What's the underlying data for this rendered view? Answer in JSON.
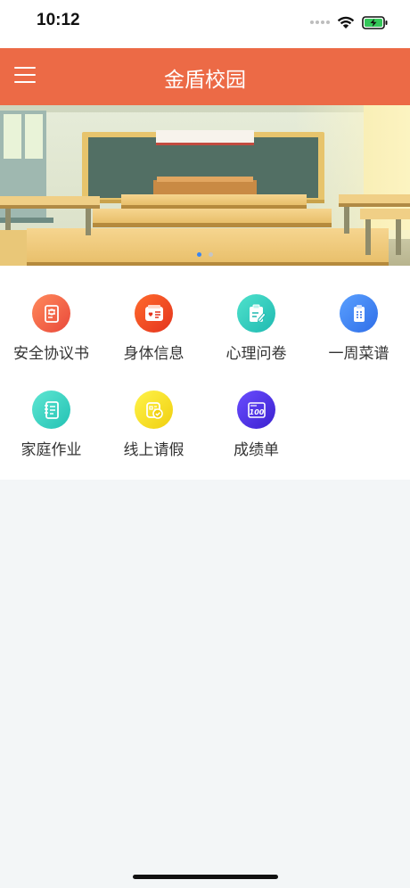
{
  "status_bar": {
    "time": "10:12"
  },
  "nav": {
    "title": "金盾校园",
    "menu_icon": "hamburger-menu-icon"
  },
  "banner": {
    "image": "classroom-illustration",
    "page_count": 2,
    "active_page": 1,
    "dot_active_color": "#3a86f0",
    "dot_inactive_color": "#c5c5c5"
  },
  "theme": {
    "accent": "#ec6a46",
    "background": "#f3f6f7"
  },
  "grid": {
    "items": [
      {
        "label": "安全协议书",
        "icon": "safety-agreement-icon",
        "colors": [
          "#ff8a5c",
          "#e9483a"
        ]
      },
      {
        "label": "身体信息",
        "icon": "health-info-icon",
        "colors": [
          "#ff6a2c",
          "#e4341e"
        ]
      },
      {
        "label": "心理问卷",
        "icon": "psychology-questionnaire-icon",
        "colors": [
          "#4fe2cc",
          "#1fb9b1"
        ]
      },
      {
        "label": "一周菜谱",
        "icon": "weekly-menu-icon",
        "colors": [
          "#5aa0ff",
          "#2f6ee8"
        ]
      },
      {
        "label": "家庭作业",
        "icon": "homework-icon",
        "colors": [
          "#5ee6d2",
          "#23c2b4"
        ]
      },
      {
        "label": "线上请假",
        "icon": "online-leave-icon",
        "colors": [
          "#fff34a",
          "#f0cf0f"
        ]
      },
      {
        "label": "成绩单",
        "icon": "transcript-icon",
        "colors": [
          "#6a4dff",
          "#3b21cf"
        ]
      }
    ]
  }
}
